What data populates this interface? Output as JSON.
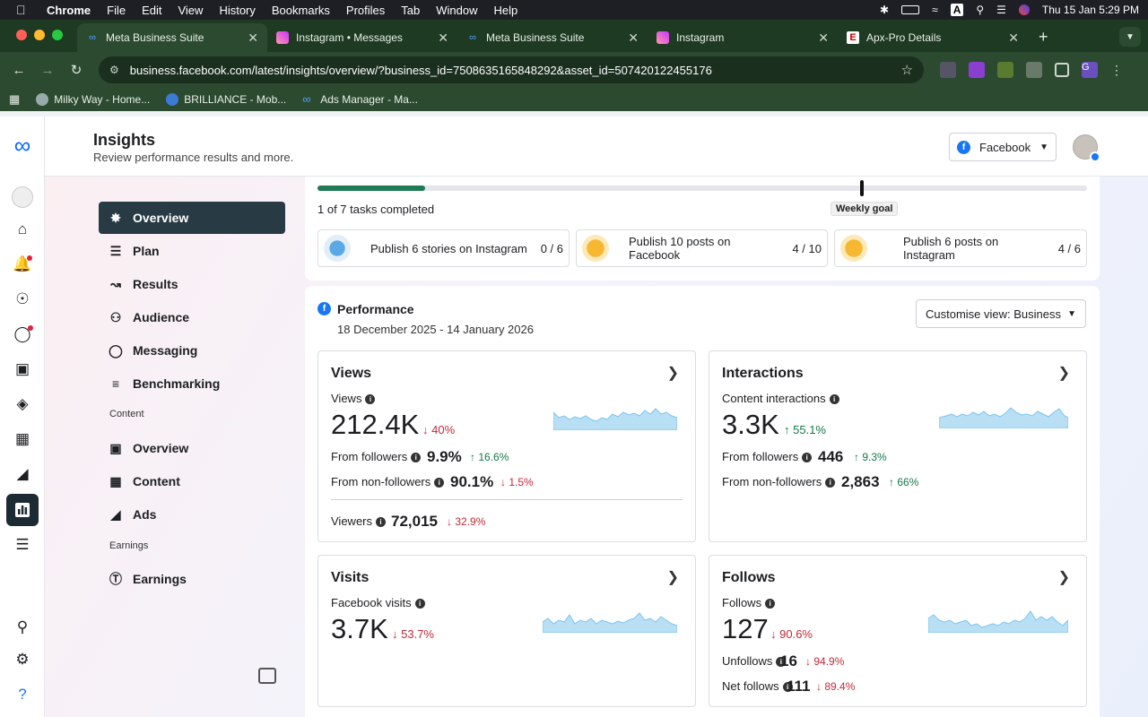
{
  "menubar": {
    "app": "Chrome",
    "items": [
      "File",
      "Edit",
      "View",
      "History",
      "Bookmarks",
      "Profiles",
      "Tab",
      "Window",
      "Help"
    ],
    "clock": "Thu 15 Jan  5:29 PM"
  },
  "tabs": [
    {
      "label": "Meta Business Suite",
      "icon": "meta-icon",
      "active": true
    },
    {
      "label": "Instagram • Messages",
      "icon": "instagram-icon"
    },
    {
      "label": "Meta Business Suite",
      "icon": "meta-icon"
    },
    {
      "label": "Instagram",
      "icon": "instagram-icon"
    },
    {
      "label": "Apx-Pro Details",
      "icon": "apx-icon"
    }
  ],
  "toolbar": {
    "url": "business.facebook.com/latest/insights/overview/?business_id=7508635165848292&asset_id=507420122455176",
    "profile_initial": "G"
  },
  "bookmarks": [
    {
      "label": "Milky Way - Home..."
    },
    {
      "label": "BRILLIANCE - Mob..."
    },
    {
      "label": "Ads Manager - Ma..."
    }
  ],
  "header": {
    "title": "Insights",
    "subtitle": "Review performance results and more.",
    "platform_select": "Facebook"
  },
  "sidenav": {
    "items": [
      {
        "label": "Overview",
        "icon": "overview-icon",
        "active": true
      },
      {
        "label": "Plan",
        "icon": "plan-icon"
      },
      {
        "label": "Results",
        "icon": "results-icon"
      },
      {
        "label": "Audience",
        "icon": "audience-icon"
      },
      {
        "label": "Messaging",
        "icon": "messaging-icon"
      },
      {
        "label": "Benchmarking",
        "icon": "benchmarking-icon"
      }
    ],
    "content_section": "Content",
    "content_items": [
      {
        "label": "Overview",
        "icon": "content-overview-icon"
      },
      {
        "label": "Content",
        "icon": "content-icon"
      },
      {
        "label": "Ads",
        "icon": "ads-icon"
      }
    ],
    "earnings_section": "Earnings",
    "earnings_items": [
      {
        "label": "Earnings",
        "icon": "earnings-icon"
      }
    ]
  },
  "goals": {
    "progress_fraction": 0.14,
    "tasks_text": "1 of 7 tasks completed",
    "weekly_goal_label": "Weekly goal",
    "tasks": [
      {
        "name": "Publish 6 stories on Instagram",
        "count": "0 / 6"
      },
      {
        "name": "Publish 10 posts on Facebook",
        "count": "4 / 10"
      },
      {
        "name": "Publish 6 posts on Instagram",
        "count": "4 / 6"
      }
    ]
  },
  "performance": {
    "title": "Performance",
    "date_range": "18 December 2025 - 14 January 2026",
    "customise_label": "Customise view: Business",
    "cards": {
      "views": {
        "title": "Views",
        "metric_label": "Views",
        "value": "212.4K",
        "delta": "40%",
        "followers_label": "From followers",
        "followers_value": "9.9%",
        "followers_delta": "16.6%",
        "nonfollowers_label": "From non-followers",
        "nonfollowers_value": "90.1%",
        "nonfollowers_delta": "1.5%",
        "viewers_label": "Viewers",
        "viewers_value": "72,015",
        "viewers_delta": "32.9%"
      },
      "interactions": {
        "title": "Interactions",
        "metric_label": "Content interactions",
        "value": "3.3K",
        "delta": "55.1%",
        "followers_label": "From followers",
        "followers_value": "446",
        "followers_delta": "9.3%",
        "nonfollowers_label": "From non-followers",
        "nonfollowers_value": "2,863",
        "nonfollowers_delta": "66%"
      },
      "visits": {
        "title": "Visits",
        "metric_label": "Facebook visits",
        "value": "3.7K",
        "delta": "53.7%"
      },
      "follows": {
        "title": "Follows",
        "metric_label": "Follows",
        "value": "127",
        "delta": "90.6%",
        "unfollows_label": "Unfollows",
        "unfollows_value": "16",
        "unfollows_delta": "94.9%",
        "net_label": "Net follows",
        "net_value": "111",
        "net_delta": "89.4%"
      }
    },
    "spark_color": "#b9dff5"
  }
}
